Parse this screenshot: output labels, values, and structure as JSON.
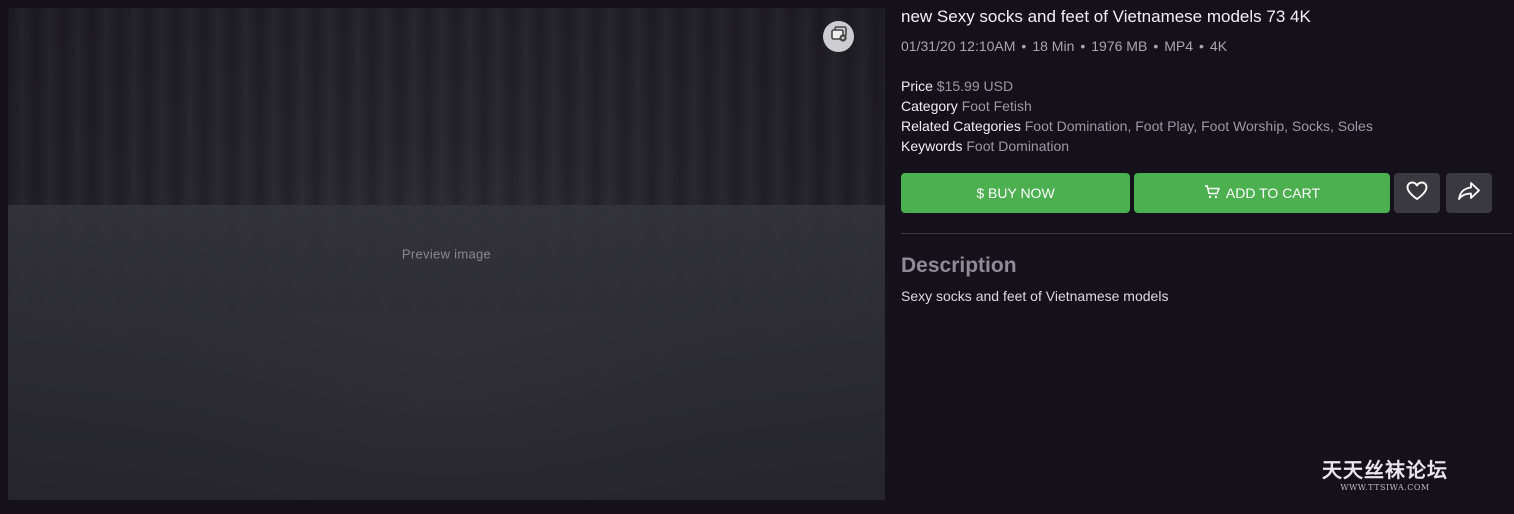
{
  "product": {
    "title": "new Sexy socks and feet of Vietnamese models 73 4K",
    "meta": {
      "date": "01/31/20 12:10AM",
      "duration": "18 Min",
      "size": "1976 MB",
      "format": "MP4",
      "quality": "4K",
      "separator": "•"
    },
    "details": {
      "price_label": "Price",
      "price_value": "$15.99 USD",
      "category_label": "Category",
      "category_value": "Foot Fetish",
      "related_label": "Related Categories",
      "related_value": "Foot Domination, Foot Play, Foot Worship, Socks, Soles",
      "keywords_label": "Keywords",
      "keywords_value": "Foot Domination"
    }
  },
  "media": {
    "preview_note": "Preview image",
    "gallery_icon": "gallery-icon"
  },
  "actions": {
    "buy_now": "$ BUY NOW",
    "add_to_cart": "ADD TO CART",
    "cart_icon": "cart-icon",
    "favorite_icon": "heart-icon",
    "share_icon": "share-icon"
  },
  "description": {
    "heading": "Description",
    "text": "Sexy socks and feet of Vietnamese models"
  },
  "watermark": {
    "title": "天天丝袜论坛",
    "url": "WWW.TTSIWA.COM"
  },
  "colors": {
    "background": "#15111b",
    "accent_green": "#4caf50",
    "icon_button": "#3a3940"
  }
}
